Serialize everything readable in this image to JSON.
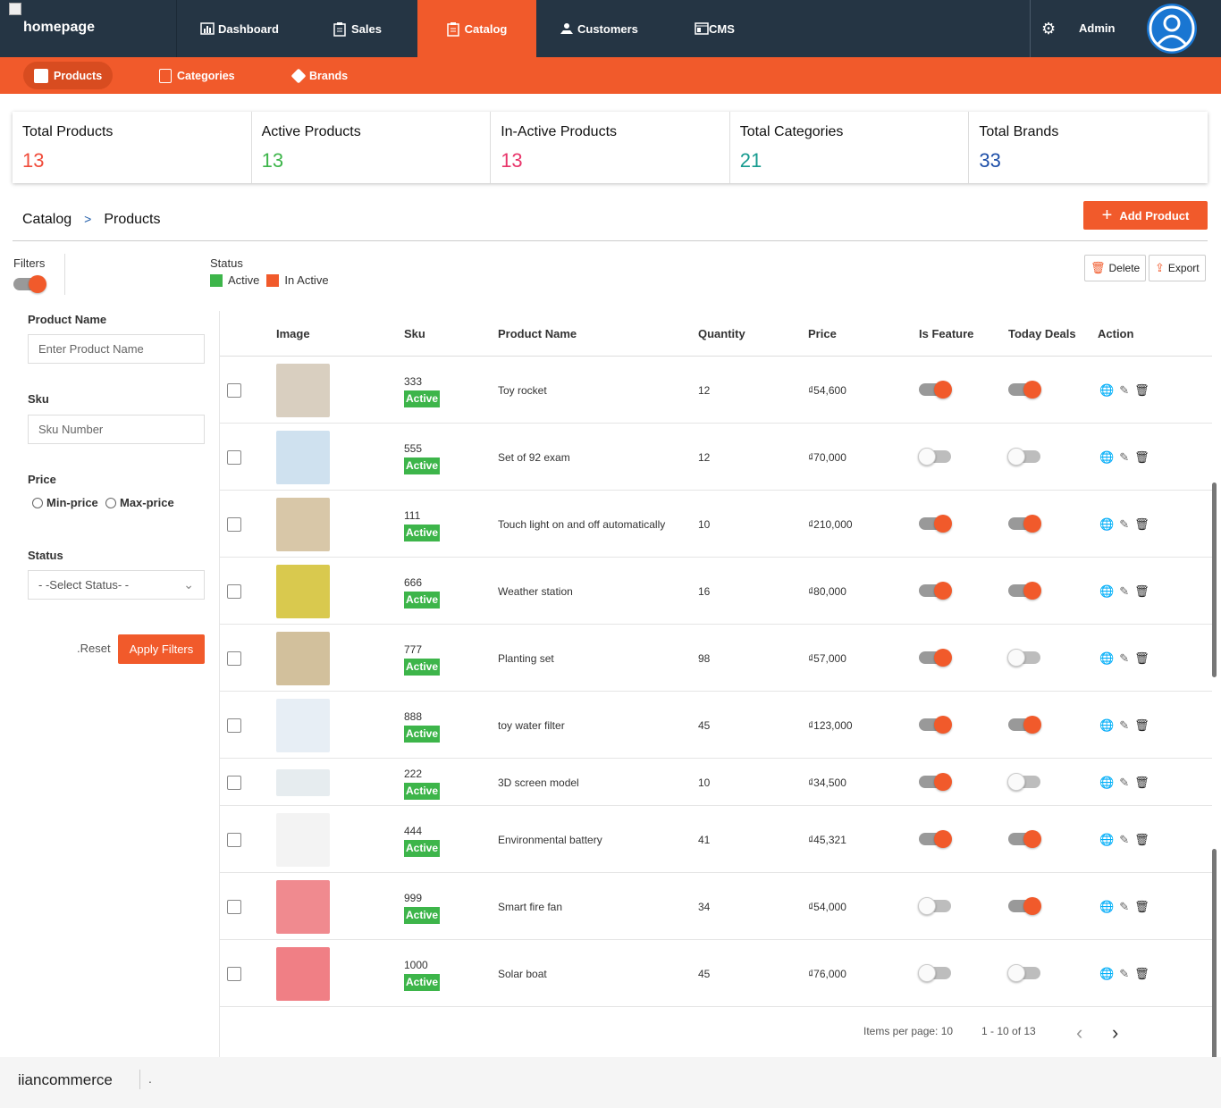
{
  "topnav": {
    "logo_text": "homepage",
    "items": [
      {
        "label": "Dashboard",
        "icon": "dashboard-icon"
      },
      {
        "label": "Sales",
        "icon": "clipboard-icon"
      },
      {
        "label": "Catalog",
        "icon": "clipboard-icon",
        "active": true
      },
      {
        "label": "Customers",
        "icon": "hand-icon"
      },
      {
        "label": "CMS",
        "icon": "web-icon"
      }
    ],
    "admin_label": "Admin"
  },
  "subnav": {
    "items": [
      {
        "label": "Products",
        "active": true
      },
      {
        "label": "Categories"
      },
      {
        "label": "Brands"
      }
    ]
  },
  "stats": [
    {
      "label": "Total Products",
      "value": "13",
      "color": "#f04b3a"
    },
    {
      "label": "Active Products",
      "value": "13",
      "color": "#3db54a"
    },
    {
      "label": "In-Active Products",
      "value": "13",
      "color": "#e8356a"
    },
    {
      "label": "Total Categories",
      "value": "21",
      "color": "#169b8f"
    },
    {
      "label": "Total Brands",
      "value": "33",
      "color": "#1e4fa8"
    }
  ],
  "breadcrumb": {
    "root": "Catalog",
    "sep": ">",
    "current": "Products"
  },
  "add_button": "Add Product",
  "filters_label": "Filters",
  "status_legend": {
    "title": "Status",
    "active": "Active",
    "inactive": "In Active",
    "active_color": "#3db54a",
    "inactive_color": "#f15a2b"
  },
  "delete_button": "Delete",
  "export_button": "Export",
  "filter_form": {
    "product_name_label": "Product Name",
    "product_name_placeholder": "Enter Product Name",
    "sku_label": "Sku",
    "sku_placeholder": "Sku Number",
    "price_label": "Price",
    "min_price": "Min-price",
    "max_price": "Max-price",
    "status_label": "Status",
    "status_placeholder": "- -Select Status- -",
    "reset": ".Reset",
    "apply": "Apply Filters"
  },
  "table": {
    "headers": [
      "Image",
      "Sku",
      "Product Name",
      "Quantity",
      "Price",
      "Is Feature",
      "Today Deals",
      "Action"
    ],
    "rows": [
      {
        "sku": "333",
        "status": "Active",
        "name": "Toy rocket",
        "qty": "12",
        "price": "₫54,600",
        "feature": true,
        "deal": true,
        "thumb": "#d9cfc0"
      },
      {
        "sku": "555",
        "status": "Active",
        "name": "Set of 92 exam",
        "qty": "12",
        "price": "₫70,000",
        "feature": false,
        "deal": false,
        "thumb": "#cfe1ef"
      },
      {
        "sku": "111",
        "status": "Active",
        "name": "Touch light on and off automatically",
        "qty": "10",
        "price": "₫210,000",
        "feature": true,
        "deal": true,
        "thumb": "#d8c7a8"
      },
      {
        "sku": "666",
        "status": "Active",
        "name": "Weather station",
        "qty": "16",
        "price": "₫80,000",
        "feature": true,
        "deal": true,
        "thumb": "#d9c94e"
      },
      {
        "sku": "777",
        "status": "Active",
        "name": "Planting set",
        "qty": "98",
        "price": "₫57,000",
        "feature": true,
        "deal": false,
        "thumb": "#d2c09c"
      },
      {
        "sku": "888",
        "status": "Active",
        "name": "toy water filter",
        "qty": "45",
        "price": "₫123,000",
        "feature": true,
        "deal": true,
        "thumb": "#e7eef5"
      },
      {
        "sku": "222",
        "status": "Active",
        "name": "3D screen model",
        "qty": "10",
        "price": "₫34,500",
        "feature": true,
        "deal": false,
        "thumb": "#e6ecef"
      },
      {
        "sku": "444",
        "status": "Active",
        "name": "Environmental battery",
        "qty": "41",
        "price": "₫45,321",
        "feature": true,
        "deal": true,
        "thumb": "#f3f3f3"
      },
      {
        "sku": "999",
        "status": "Active",
        "name": "Smart fire fan",
        "qty": "34",
        "price": "₫54,000",
        "feature": false,
        "deal": true,
        "thumb": "#f08a8f"
      },
      {
        "sku": "1000",
        "status": "Active",
        "name": "Solar boat",
        "qty": "45",
        "price": "₫76,000",
        "feature": false,
        "deal": false,
        "thumb": "#f07f85"
      }
    ]
  },
  "pagination": {
    "items_per_page": "Items per page: 10",
    "range": "1 - 10 of 13"
  },
  "footer": {
    "brand": "iiancommerce",
    "dot": "."
  }
}
